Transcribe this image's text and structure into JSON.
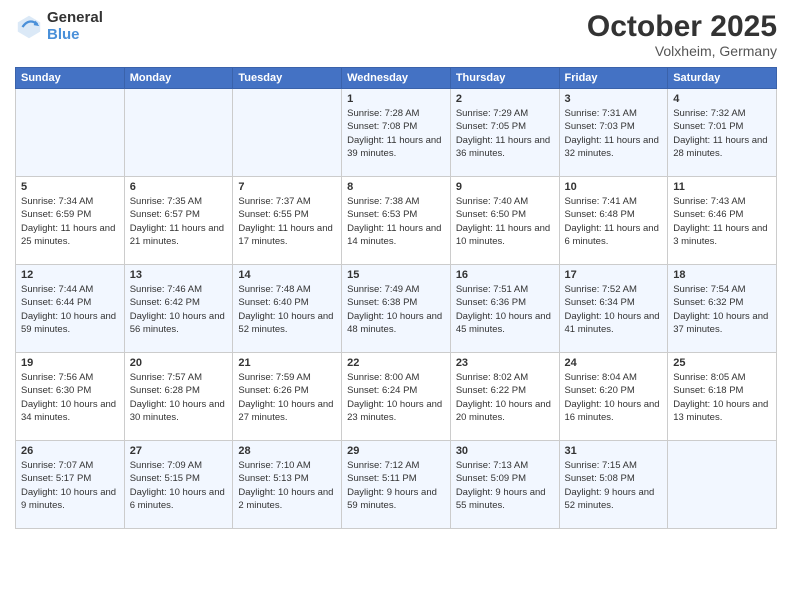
{
  "logo": {
    "general": "General",
    "blue": "Blue"
  },
  "title": "October 2025",
  "location": "Volxheim, Germany",
  "headers": [
    "Sunday",
    "Monday",
    "Tuesday",
    "Wednesday",
    "Thursday",
    "Friday",
    "Saturday"
  ],
  "weeks": [
    [
      {
        "day": "",
        "info": ""
      },
      {
        "day": "",
        "info": ""
      },
      {
        "day": "",
        "info": ""
      },
      {
        "day": "1",
        "info": "Sunrise: 7:28 AM\nSunset: 7:08 PM\nDaylight: 11 hours and 39 minutes."
      },
      {
        "day": "2",
        "info": "Sunrise: 7:29 AM\nSunset: 7:05 PM\nDaylight: 11 hours and 36 minutes."
      },
      {
        "day": "3",
        "info": "Sunrise: 7:31 AM\nSunset: 7:03 PM\nDaylight: 11 hours and 32 minutes."
      },
      {
        "day": "4",
        "info": "Sunrise: 7:32 AM\nSunset: 7:01 PM\nDaylight: 11 hours and 28 minutes."
      }
    ],
    [
      {
        "day": "5",
        "info": "Sunrise: 7:34 AM\nSunset: 6:59 PM\nDaylight: 11 hours and 25 minutes."
      },
      {
        "day": "6",
        "info": "Sunrise: 7:35 AM\nSunset: 6:57 PM\nDaylight: 11 hours and 21 minutes."
      },
      {
        "day": "7",
        "info": "Sunrise: 7:37 AM\nSunset: 6:55 PM\nDaylight: 11 hours and 17 minutes."
      },
      {
        "day": "8",
        "info": "Sunrise: 7:38 AM\nSunset: 6:53 PM\nDaylight: 11 hours and 14 minutes."
      },
      {
        "day": "9",
        "info": "Sunrise: 7:40 AM\nSunset: 6:50 PM\nDaylight: 11 hours and 10 minutes."
      },
      {
        "day": "10",
        "info": "Sunrise: 7:41 AM\nSunset: 6:48 PM\nDaylight: 11 hours and 6 minutes."
      },
      {
        "day": "11",
        "info": "Sunrise: 7:43 AM\nSunset: 6:46 PM\nDaylight: 11 hours and 3 minutes."
      }
    ],
    [
      {
        "day": "12",
        "info": "Sunrise: 7:44 AM\nSunset: 6:44 PM\nDaylight: 10 hours and 59 minutes."
      },
      {
        "day": "13",
        "info": "Sunrise: 7:46 AM\nSunset: 6:42 PM\nDaylight: 10 hours and 56 minutes."
      },
      {
        "day": "14",
        "info": "Sunrise: 7:48 AM\nSunset: 6:40 PM\nDaylight: 10 hours and 52 minutes."
      },
      {
        "day": "15",
        "info": "Sunrise: 7:49 AM\nSunset: 6:38 PM\nDaylight: 10 hours and 48 minutes."
      },
      {
        "day": "16",
        "info": "Sunrise: 7:51 AM\nSunset: 6:36 PM\nDaylight: 10 hours and 45 minutes."
      },
      {
        "day": "17",
        "info": "Sunrise: 7:52 AM\nSunset: 6:34 PM\nDaylight: 10 hours and 41 minutes."
      },
      {
        "day": "18",
        "info": "Sunrise: 7:54 AM\nSunset: 6:32 PM\nDaylight: 10 hours and 37 minutes."
      }
    ],
    [
      {
        "day": "19",
        "info": "Sunrise: 7:56 AM\nSunset: 6:30 PM\nDaylight: 10 hours and 34 minutes."
      },
      {
        "day": "20",
        "info": "Sunrise: 7:57 AM\nSunset: 6:28 PM\nDaylight: 10 hours and 30 minutes."
      },
      {
        "day": "21",
        "info": "Sunrise: 7:59 AM\nSunset: 6:26 PM\nDaylight: 10 hours and 27 minutes."
      },
      {
        "day": "22",
        "info": "Sunrise: 8:00 AM\nSunset: 6:24 PM\nDaylight: 10 hours and 23 minutes."
      },
      {
        "day": "23",
        "info": "Sunrise: 8:02 AM\nSunset: 6:22 PM\nDaylight: 10 hours and 20 minutes."
      },
      {
        "day": "24",
        "info": "Sunrise: 8:04 AM\nSunset: 6:20 PM\nDaylight: 10 hours and 16 minutes."
      },
      {
        "day": "25",
        "info": "Sunrise: 8:05 AM\nSunset: 6:18 PM\nDaylight: 10 hours and 13 minutes."
      }
    ],
    [
      {
        "day": "26",
        "info": "Sunrise: 7:07 AM\nSunset: 5:17 PM\nDaylight: 10 hours and 9 minutes."
      },
      {
        "day": "27",
        "info": "Sunrise: 7:09 AM\nSunset: 5:15 PM\nDaylight: 10 hours and 6 minutes."
      },
      {
        "day": "28",
        "info": "Sunrise: 7:10 AM\nSunset: 5:13 PM\nDaylight: 10 hours and 2 minutes."
      },
      {
        "day": "29",
        "info": "Sunrise: 7:12 AM\nSunset: 5:11 PM\nDaylight: 9 hours and 59 minutes."
      },
      {
        "day": "30",
        "info": "Sunrise: 7:13 AM\nSunset: 5:09 PM\nDaylight: 9 hours and 55 minutes."
      },
      {
        "day": "31",
        "info": "Sunrise: 7:15 AM\nSunset: 5:08 PM\nDaylight: 9 hours and 52 minutes."
      },
      {
        "day": "",
        "info": ""
      }
    ]
  ]
}
